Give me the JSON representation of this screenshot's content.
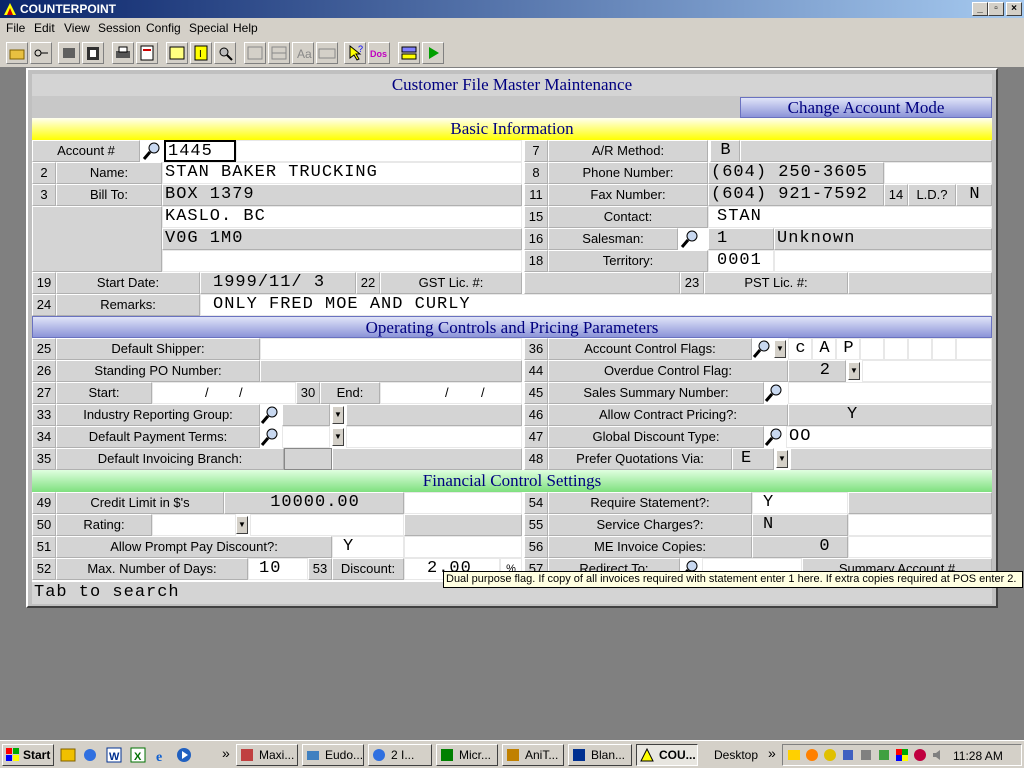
{
  "app": {
    "title": "COUNTERPOINT"
  },
  "menu": [
    "File",
    "Edit",
    "View",
    "Session",
    "Config",
    "Special",
    "Help"
  ],
  "form": {
    "title": "Customer File Master Maintenance",
    "mode": "Change Account Mode",
    "sections": {
      "basic": "Basic Information",
      "operating": "Operating Controls and Pricing Parameters",
      "financial": "Financial Control Settings"
    },
    "labels": {
      "account": "Account #",
      "ar_method": "A/R Method:",
      "name": "Name:",
      "phone": "Phone Number:",
      "bill_to": "Bill To:",
      "fax": "Fax Number:",
      "ld": "L.D.?",
      "contact": "Contact:",
      "salesman": "Salesman:",
      "territory": "Territory:",
      "start_date": "Start Date:",
      "gst": "GST Lic. #:",
      "pst": "PST Lic. #:",
      "remarks": "Remarks:",
      "default_shipper": "Default Shipper:",
      "account_control_flags": "Account Control Flags:",
      "standing_po": "Standing PO Number:",
      "overdue_control": "Overdue Control Flag:",
      "start": "Start:",
      "end": "End:",
      "sales_summary": "Sales Summary Number:",
      "industry_group": "Industry Reporting Group:",
      "allow_contract": "Allow Contract Pricing?:",
      "default_payment": "Default Payment Terms:",
      "global_discount": "Global Discount Type:",
      "default_invoicing": "Default Invoicing Branch:",
      "prefer_quotations": "Prefer Quotations Via:",
      "credit_limit": "Credit Limit in $'s",
      "require_statement": "Require Statement?:",
      "rating": "Rating:",
      "service_charges": "Service Charges?:",
      "allow_prompt": "Allow Prompt Pay Discount?:",
      "me_invoice": "ME Invoice Copies:",
      "max_days": "Max. Number of Days:",
      "discount": "Discount:",
      "redirect_to": "Redirect To:",
      "summary_account": "Summary Account #"
    },
    "numbers": {
      "n2": "2",
      "n3": "3",
      "n7": "7",
      "n8": "8",
      "n11": "11",
      "n14": "14",
      "n15": "15",
      "n16": "16",
      "n18": "18",
      "n19": "19",
      "n22": "22",
      "n23": "23",
      "n24": "24",
      "n25": "25",
      "n26": "26",
      "n27": "27",
      "n30": "30",
      "n33": "33",
      "n34": "34",
      "n35": "35",
      "n36": "36",
      "n44": "44",
      "n45": "45",
      "n46": "46",
      "n47": "47",
      "n48": "48",
      "n49": "49",
      "n50": "50",
      "n51": "51",
      "n52": "52",
      "n53": "53",
      "n54": "54",
      "n55": "55",
      "n56": "56",
      "n57": "57"
    },
    "values": {
      "account": "1445",
      "ar_method": "B",
      "name": "STAN BAKER TRUCKING",
      "phone_area": "604",
      "phone_prefix": "250",
      "phone_line": "3605",
      "bill_to_1": "BOX 1379",
      "bill_to_2": "KASLO. BC",
      "bill_to_3": "V0G 1M0",
      "fax_area": "604",
      "fax_prefix": "921",
      "fax_line": "7592",
      "ld": "N",
      "contact": "STAN",
      "salesman_code": "1",
      "salesman_name": "Unknown",
      "territory": "0001",
      "start_year": "1999",
      "start_month": "11",
      "start_day": "3",
      "remarks": "ONLY FRED MOE AND CURLY",
      "acf_1": "c",
      "acf_2": "A",
      "acf_3": "P",
      "overdue_control": "2",
      "allow_contract": "Y",
      "global_discount": "OO",
      "prefer_quotations": "E",
      "credit_limit": "10000.00",
      "require_statement": "Y",
      "service_charges": "N",
      "allow_prompt": "Y",
      "me_invoice": "0",
      "max_days": "10",
      "discount": "2.00",
      "percent": "%"
    },
    "tooltip": "Dual purpose flag. If copy of all invoices required with statement enter 1 here. If extra copies required at POS enter 2.",
    "status": "Tab to search"
  },
  "taskbar": {
    "start": "Start",
    "tasks": [
      "Maxi...",
      "Eudo...",
      "2 I...",
      "Micr...",
      "AniT...",
      "Blan...",
      "COU..."
    ],
    "desktop": "Desktop",
    "clock": "11:28 AM"
  },
  "colors": {
    "titlebar": "#0a246a",
    "section_blue": "#8c94d8",
    "section_yellow": "#ffff00",
    "section_green": "#7fe07f"
  }
}
